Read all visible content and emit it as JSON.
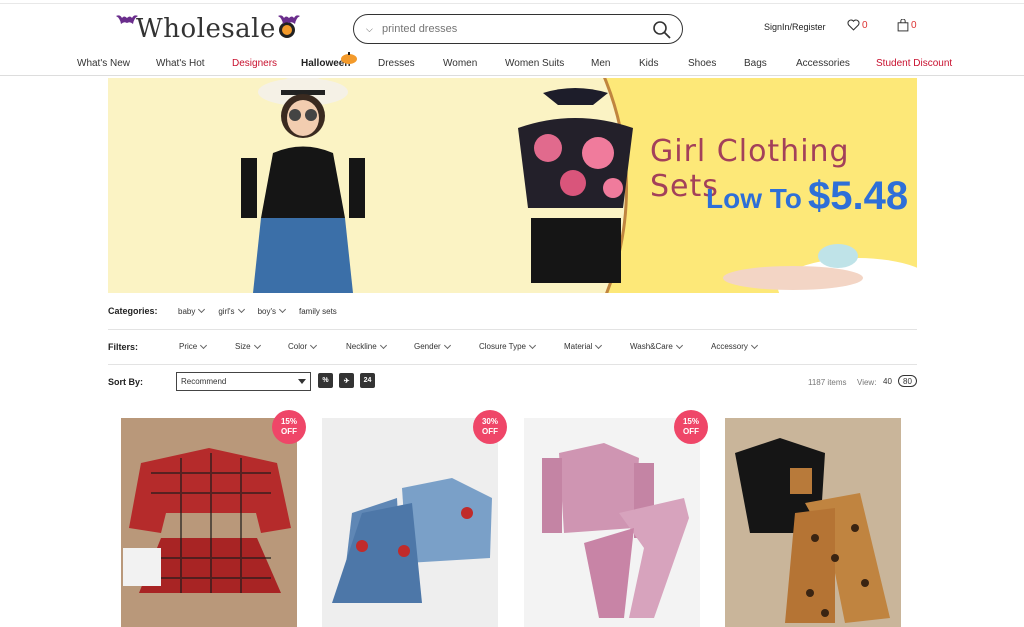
{
  "header": {
    "logo_text": "Wholesale",
    "search_placeholder": "printed dresses",
    "account_label": "SignIn/Register",
    "wishlist_count": "0",
    "cart_count": "0"
  },
  "nav": {
    "items": [
      {
        "label": "What's New"
      },
      {
        "label": "What's Hot"
      },
      {
        "label": "Designers"
      },
      {
        "label": "Halloween"
      },
      {
        "label": "Dresses"
      },
      {
        "label": "Women"
      },
      {
        "label": "Women Suits"
      },
      {
        "label": "Men"
      },
      {
        "label": "Kids"
      },
      {
        "label": "Shoes"
      },
      {
        "label": "Bags"
      },
      {
        "label": "Accessories"
      },
      {
        "label": "Student Discount"
      }
    ]
  },
  "banner": {
    "title": "Girl Clothing Sets",
    "price_prefix": "Low To",
    "price": "$5.48"
  },
  "categories": {
    "label": "Categories:",
    "items": [
      "baby",
      "girl's",
      "boy's",
      "family sets"
    ]
  },
  "filters": {
    "label": "Filters:",
    "items": [
      "Price",
      "Size",
      "Color",
      "Neckline",
      "Gender",
      "Closure Type",
      "Material",
      "Wash&Care",
      "Accessory"
    ]
  },
  "sort": {
    "label": "Sort By:",
    "selected": "Recommend",
    "btn_percent": "%",
    "btn_plane": "✈",
    "btn_24": "24",
    "items_count": "1187 items",
    "view_label": "View:",
    "view_40": "40",
    "view_80": "80"
  },
  "products": [
    {
      "badge_pct": "15%",
      "badge_off": "OFF"
    },
    {
      "badge_pct": "30%",
      "badge_off": "OFF"
    },
    {
      "badge_pct": "15%",
      "badge_off": "OFF"
    },
    {
      "badge_pct": "",
      "badge_off": ""
    }
  ],
  "colors": {
    "badge": "#ef4668",
    "accent_red": "#c8102e",
    "banner_bg": "#fde878",
    "banner_blue": "#2e6fd8"
  }
}
